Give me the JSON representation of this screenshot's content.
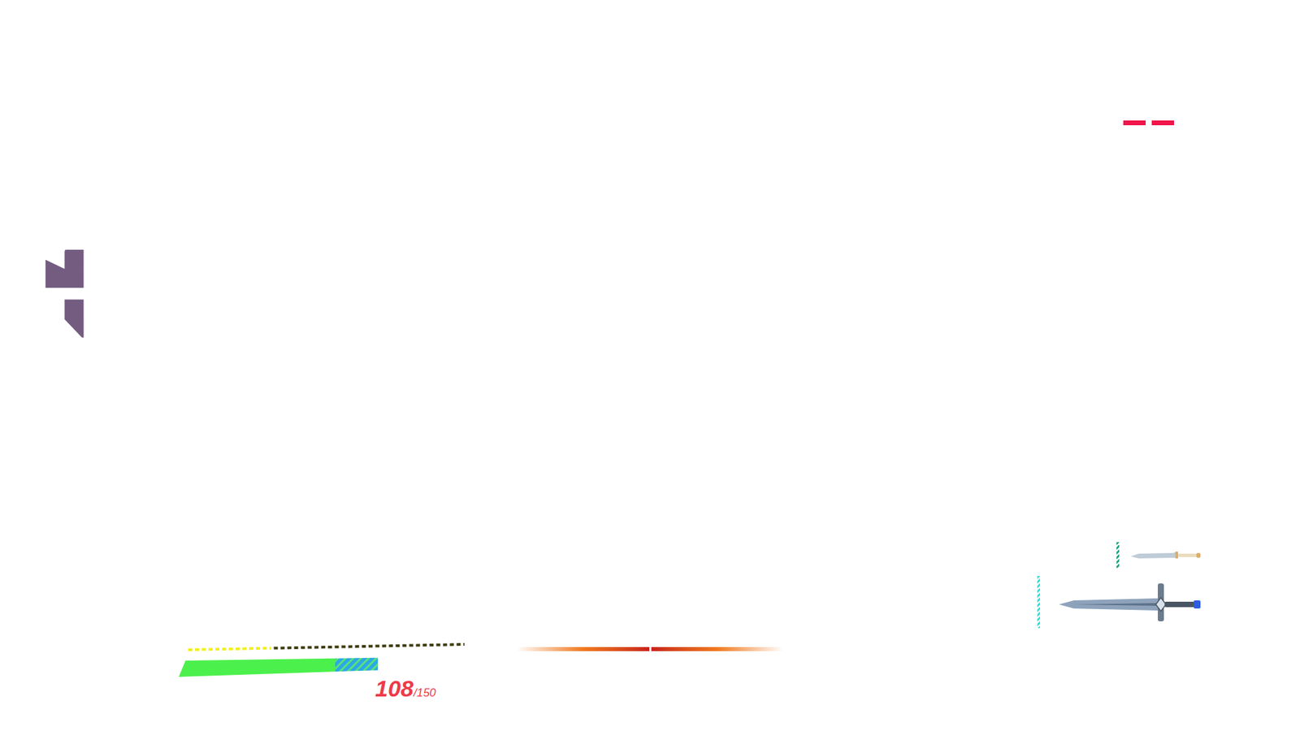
{
  "markers": [
    {
      "filled": true
    },
    {
      "filled": true
    }
  ],
  "stamina": {
    "level": 0.3
  },
  "health": {
    "value": "108",
    "max": "/150",
    "level": 0.55,
    "shield_level": 0.15
  },
  "weapons": [
    {
      "kind": "knife",
      "selected": false,
      "color": "#149a78"
    },
    {
      "kind": "sword",
      "selected": true,
      "color": "#2ce6da"
    }
  ]
}
